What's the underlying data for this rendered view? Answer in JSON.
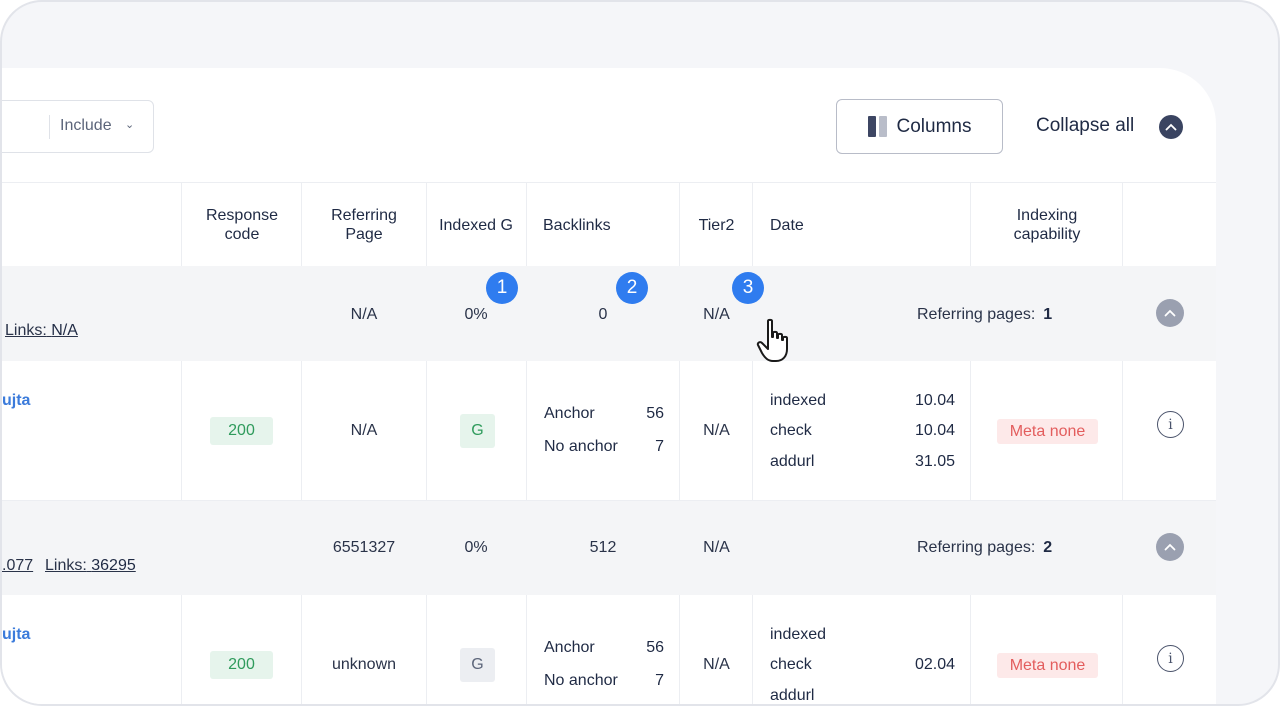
{
  "toolbar": {
    "filter_mode": "Include",
    "columns_label": "Columns",
    "collapse_all_label": "Collapse all"
  },
  "table": {
    "headers": {
      "response_code": "Response\ncode",
      "referring_page": "Referring\nPage",
      "indexed_g": "Indexed G",
      "backlinks": "Backlinks",
      "tier2": "Tier2",
      "date": "Date",
      "indexing_capability": "Indexing\ncapability"
    },
    "groups": [
      {
        "links_label": "Links:",
        "links_value": "N/A",
        "referring_page": "N/A",
        "indexed": "0%",
        "backlinks": "0",
        "tier2": "N/A",
        "referring_pages_label": "Referring pages:",
        "referring_pages_value": "1"
      },
      {
        "prefix_value": ".077",
        "links_label": "Links:",
        "links_value": "36295",
        "referring_page": "6551327",
        "indexed": "0%",
        "backlinks": "512",
        "tier2": "N/A",
        "referring_pages_label": "Referring pages:",
        "referring_pages_value": "2"
      }
    ],
    "details": [
      {
        "url_fragment": "ujta",
        "response_code": "200",
        "referring_page": "N/A",
        "indexed_badge": "G",
        "anchor_label": "Anchor",
        "anchor_count": "56",
        "no_anchor_label": "No anchor",
        "no_anchor_count": "7",
        "tier2": "N/A",
        "dates": [
          {
            "label": "indexed",
            "value": "10.04"
          },
          {
            "label": "check",
            "value": "10.04"
          },
          {
            "label": "addurl",
            "value": "31.05"
          }
        ],
        "indexing": "Meta none"
      },
      {
        "url_fragment": "ujta",
        "response_code": "200",
        "referring_page": "unknown",
        "indexed_badge": "G",
        "anchor_label": "Anchor",
        "anchor_count": "56",
        "no_anchor_label": "No anchor",
        "no_anchor_count": "7",
        "tier2": "N/A",
        "dates": [
          {
            "label": "indexed",
            "value": ""
          },
          {
            "label": "check",
            "value": "02.04"
          },
          {
            "label": "addurl",
            "value": ""
          }
        ],
        "indexing": "Meta none"
      }
    ]
  },
  "markers": [
    "1",
    "2",
    "3"
  ],
  "colors": {
    "accent_blue": "#2f7cef",
    "link_blue": "#3b7bdb",
    "success_green": "#2f9b5c",
    "error_red": "#e35d5d",
    "group_row_bg": "#f4f5f7"
  },
  "icons": {
    "columns": "columns-icon",
    "collapse": "chevron-up-icon",
    "expand": "chevron-up-icon",
    "info": "info-icon",
    "cursor": "hand-pointer-cursor-icon"
  }
}
